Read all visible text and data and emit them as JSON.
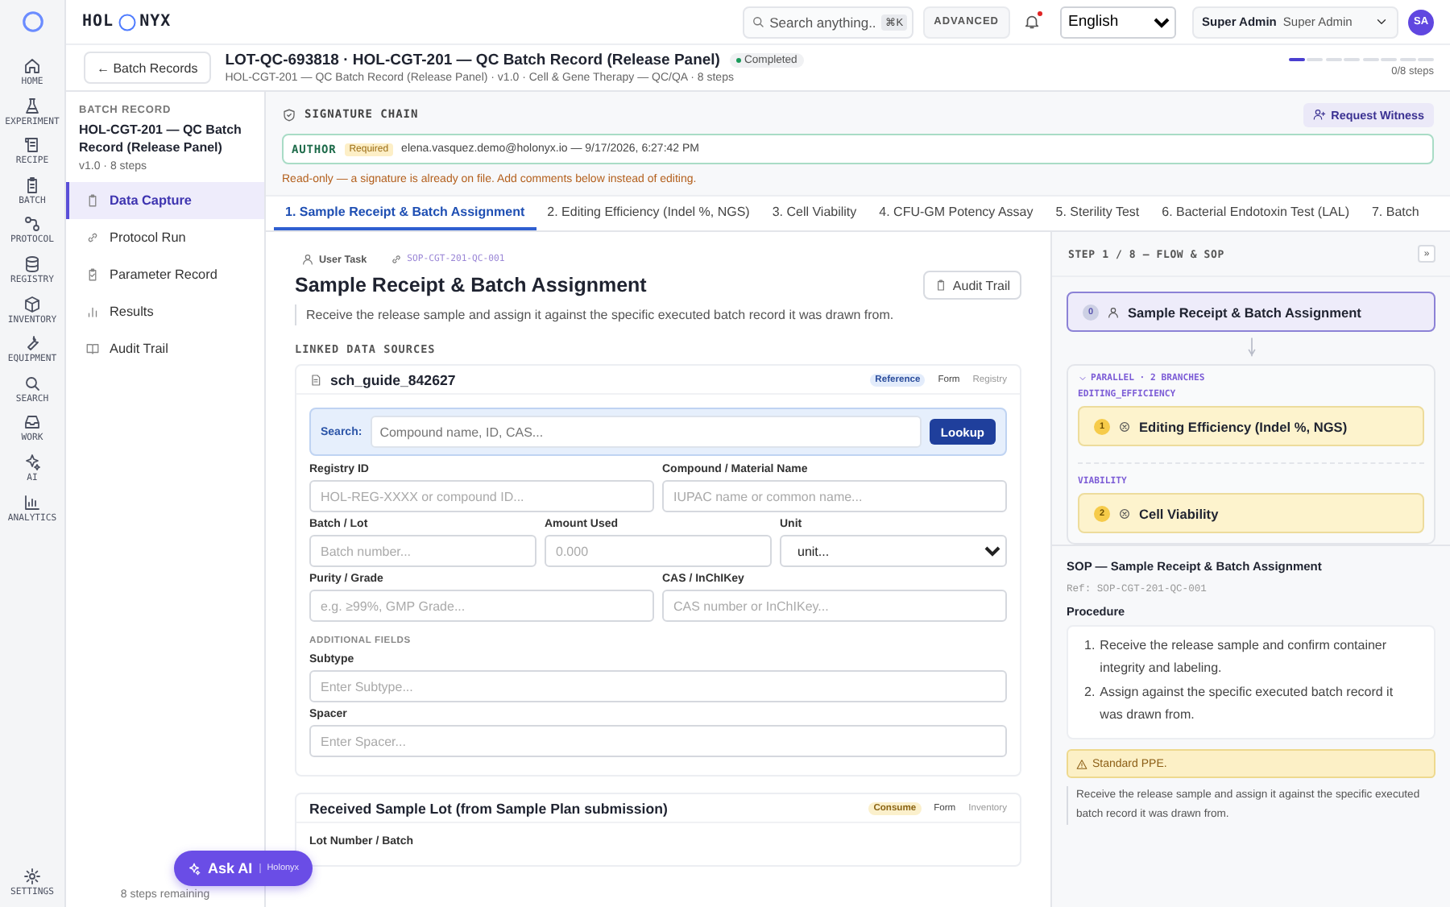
{
  "rail": {
    "items": [
      {
        "label": "HOME"
      },
      {
        "label": "EXPERIMENT"
      },
      {
        "label": "RECIPE"
      },
      {
        "label": "BATCH"
      },
      {
        "label": "PROTOCOL"
      },
      {
        "label": "REGISTRY"
      },
      {
        "label": "INVENTORY"
      },
      {
        "label": "EQUIPMENT"
      },
      {
        "label": "SEARCH"
      },
      {
        "label": "WORK"
      },
      {
        "label": "AI"
      },
      {
        "label": "ANALYTICS"
      }
    ],
    "settings": {
      "label": "SETTINGS"
    }
  },
  "topbar": {
    "brand": {
      "left": "HOL",
      "right": "NYX"
    },
    "search": {
      "placeholder": "Search anything...",
      "shortcut": "⌘K"
    },
    "advanced": "ADVANCED",
    "notifications": {
      "unread": true
    },
    "language": "English",
    "user": {
      "name": "Super Admin",
      "role": "Super Admin",
      "initials": "SA"
    }
  },
  "header": {
    "back": "← Batch Records",
    "title": "LOT-QC-693818 · HOL-CGT-201 — QC Batch Record (Release Panel)",
    "status": "Completed",
    "subtitle": "HOL-CGT-201 — QC Batch Record (Release Panel) · v1.0 · Cell & Gene Therapy — QC/QA · 8 steps",
    "progress": {
      "segments": [
        {
          "active": true
        },
        {
          "active": false
        },
        {
          "active": false
        },
        {
          "active": false
        },
        {
          "active": false
        },
        {
          "active": false
        },
        {
          "active": false
        },
        {
          "active": false
        }
      ],
      "label": "0/8 steps"
    }
  },
  "sidebar": {
    "eyebrow": "BATCH RECORD",
    "title": "HOL-CGT-201 — QC Batch Record (Release Panel)",
    "meta": "v1.0 · 8 steps",
    "items": [
      {
        "label": "Data Capture",
        "selected": true
      },
      {
        "label": "Protocol Run",
        "selected": false
      },
      {
        "label": "Parameter Record",
        "selected": false
      },
      {
        "label": "Results",
        "selected": false
      },
      {
        "label": "Audit Trail",
        "selected": false
      }
    ],
    "footer": "8 steps remaining"
  },
  "signature": {
    "title": "SIGNATURE CHAIN",
    "action": "Request Witness",
    "entries": [
      {
        "role": "AUTHOR",
        "status": "Required",
        "detail": "elena.vasquez.demo@holonyx.io — 9/17/2026, 6:27:42 PM"
      }
    ],
    "note": "Read-only — a signature is already on file. Add comments below instead of editing."
  },
  "tabs": [
    {
      "label": "1. Sample Receipt & Batch Assignment",
      "selected": true
    },
    {
      "label": "2. Editing Efficiency (Indel %, NGS)",
      "selected": false
    },
    {
      "label": "3. Cell Viability",
      "selected": false
    },
    {
      "label": "4. CFU-GM Potency Assay",
      "selected": false
    },
    {
      "label": "5. Sterility Test",
      "selected": false
    },
    {
      "label": "6. Bacterial Endotoxin Test (LAL)",
      "selected": false
    },
    {
      "label": "7. Batch",
      "selected": false
    }
  ],
  "task": {
    "type": "User Task",
    "ref": "SOP-CGT-201-QC-001",
    "title": "Sample Receipt & Batch Assignment",
    "audit": "Audit Trail",
    "description": "Receive the release sample and assign it against the specific executed batch record it was drawn from.",
    "sources_title": "LINKED DATA SOURCES",
    "sources": [
      {
        "name": "sch_guide_842627",
        "badge": {
          "label": "Reference",
          "kind": "reference"
        },
        "mode": "Form",
        "origin": "Registry",
        "search": {
          "label": "Search:",
          "placeholder": "Compound name, ID, CAS...",
          "button": "Lookup"
        },
        "rows": [
          [
            {
              "label": "Registry ID",
              "kind": "input",
              "placeholder": "HOL-REG-XXXX or compound ID..."
            },
            {
              "label": "Compound / Material Name",
              "kind": "input",
              "placeholder": "IUPAC name or common name..."
            }
          ],
          [
            {
              "label": "Batch / Lot",
              "kind": "input",
              "placeholder": "Batch number..."
            },
            {
              "label": "Amount Used",
              "kind": "input",
              "placeholder": "0.000"
            },
            {
              "label": "Unit",
              "kind": "select",
              "value": "unit..."
            }
          ],
          [
            {
              "label": "Purity / Grade",
              "kind": "input",
              "placeholder": "e.g. ≥99%, GMP Grade..."
            },
            {
              "label": "CAS / InChIKey",
              "kind": "input",
              "placeholder": "CAS number or InChIKey..."
            }
          ]
        ],
        "extra_title": "ADDITIONAL FIELDS",
        "extra": [
          {
            "label": "Subtype",
            "kind": "input",
            "placeholder": "Enter Subtype..."
          },
          {
            "label": "Spacer",
            "kind": "input",
            "placeholder": "Enter Spacer..."
          }
        ]
      },
      {
        "name": "Received Sample Lot (from Sample Plan submission)",
        "badge": {
          "label": "Consume",
          "kind": "consume"
        },
        "mode": "Form",
        "origin": "Inventory",
        "rows": [
          [
            {
              "label": "Lot Number / Batch"
            }
          ]
        ]
      }
    ]
  },
  "flow": {
    "title": "STEP 1 / 8 — FLOW & SOP",
    "collapse": "»",
    "start": {
      "badge": "0",
      "kind": "user",
      "title": "Sample Receipt & Batch Assignment",
      "selected": true
    },
    "parallel": {
      "label": "PARALLEL · 2 BRANCHES",
      "expanded": true,
      "branches": [
        {
          "name": "EDITING_EFFICIENCY",
          "badge": "1",
          "kind": "auto",
          "title": "Editing Efficiency (Indel %, NGS)",
          "selected": false
        },
        {
          "name": "VIABILITY",
          "badge": "2",
          "kind": "auto",
          "title": "Cell Viability",
          "selected": false
        }
      ]
    }
  },
  "sop": {
    "title": "SOP — Sample Receipt & Batch Assignment",
    "ref": "Ref: SOP-CGT-201-QC-001",
    "procedure_title": "Procedure",
    "steps": [
      {
        "number": "1.",
        "text": "Receive the release sample and confirm container integrity and labeling."
      },
      {
        "number": "2.",
        "text": "Assign against the specific executed batch record it was drawn from."
      }
    ],
    "warning": "Standard PPE.",
    "summary": "Receive the release sample and assign it against the specific executed batch record it was drawn from."
  },
  "assistant": {
    "label": "Ask AI",
    "brand": "Holonyx"
  }
}
